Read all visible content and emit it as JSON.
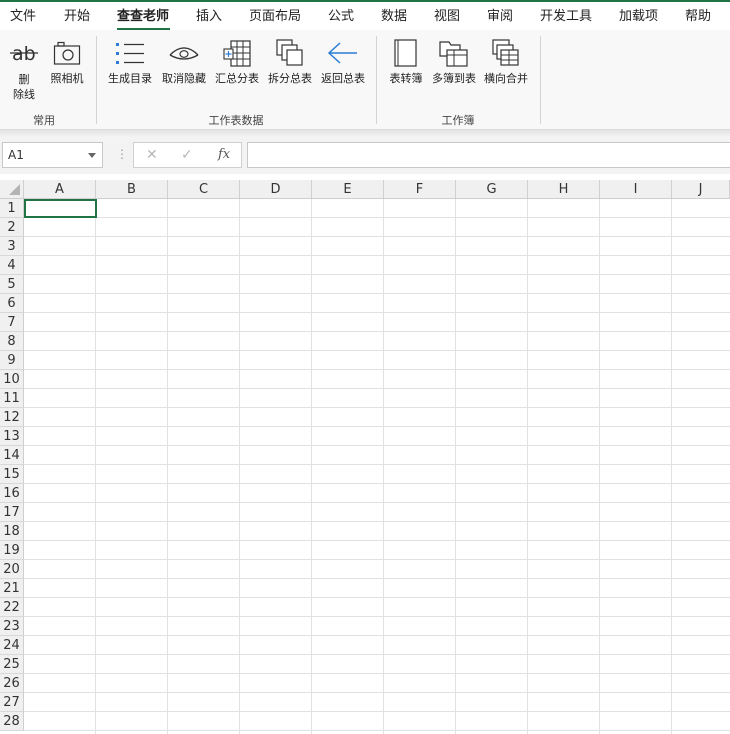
{
  "menu": {
    "tabs": [
      {
        "label": "文件"
      },
      {
        "label": "开始"
      },
      {
        "label": "查查老师",
        "active": true
      },
      {
        "label": "插入"
      },
      {
        "label": "页面布局"
      },
      {
        "label": "公式"
      },
      {
        "label": "数据"
      },
      {
        "label": "视图"
      },
      {
        "label": "审阅"
      },
      {
        "label": "开发工具"
      },
      {
        "label": "加载项"
      },
      {
        "label": "帮助"
      }
    ]
  },
  "ribbon": {
    "groups": [
      {
        "label": "常用",
        "buttons": [
          {
            "label": "删\n除线",
            "icon": "strikethrough-icon"
          },
          {
            "label": "照相机",
            "icon": "camera-icon"
          }
        ]
      },
      {
        "label": "工作表数据",
        "buttons": [
          {
            "label": "生成目录",
            "icon": "list-icon"
          },
          {
            "label": "取消隐藏",
            "icon": "eye-icon"
          },
          {
            "label": "汇总分表",
            "icon": "sheets-merge-icon"
          },
          {
            "label": "拆分总表",
            "icon": "split-sheet-icon"
          },
          {
            "label": "返回总表",
            "icon": "arrow-left-icon"
          }
        ]
      },
      {
        "label": "工作簿",
        "buttons": [
          {
            "label": "表转簿",
            "icon": "sheet-to-book-icon"
          },
          {
            "label": "多簿到表",
            "icon": "books-to-sheet-icon"
          },
          {
            "label": "横向合并",
            "icon": "horizontal-merge-icon"
          }
        ]
      }
    ]
  },
  "formula_bar": {
    "name_box": "A1",
    "dots": "⋮",
    "cancel_glyph": "✕",
    "enter_glyph": "✓",
    "fx_glyph": "fx",
    "formula": ""
  },
  "sheet": {
    "columns": [
      "A",
      "B",
      "C",
      "D",
      "E",
      "F",
      "G",
      "H",
      "I",
      "J"
    ],
    "rows": [
      "1",
      "2",
      "3",
      "4",
      "5",
      "6",
      "7",
      "8",
      "9",
      "10",
      "11",
      "12",
      "13",
      "14",
      "15",
      "16",
      "17",
      "18",
      "19",
      "20",
      "21",
      "22",
      "23",
      "24",
      "25",
      "26",
      "27",
      "28"
    ],
    "selected_cell": "A1"
  },
  "colors": {
    "accent": "#217346",
    "icon_blue": "#2b7cd3"
  }
}
